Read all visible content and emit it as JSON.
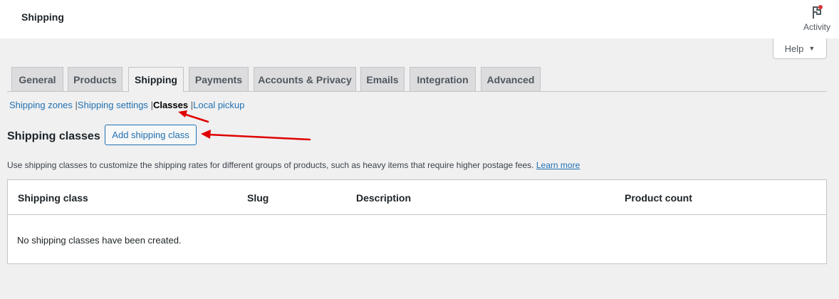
{
  "header": {
    "title": "Shipping",
    "activity_label": "Activity"
  },
  "help": {
    "label": "Help"
  },
  "tabs": [
    {
      "label": "General",
      "active": false
    },
    {
      "label": "Products",
      "active": false
    },
    {
      "label": "Shipping",
      "active": true
    },
    {
      "label": "Payments",
      "active": false
    },
    {
      "label": "Accounts & Privacy",
      "active": false
    },
    {
      "label": "Emails",
      "active": false
    },
    {
      "label": "Integration",
      "active": false
    },
    {
      "label": "Advanced",
      "active": false
    }
  ],
  "subnav": {
    "zones": "Shipping zones",
    "settings": "Shipping settings",
    "classes": "Classes",
    "local_pickup": "Local pickup",
    "separator": "|"
  },
  "section": {
    "heading": "Shipping classes",
    "add_button": "Add shipping class",
    "description": "Use shipping classes to customize the shipping rates for different groups of products, such as heavy items that require higher postage fees.",
    "learn_more": "Learn more"
  },
  "table": {
    "columns": [
      "Shipping class",
      "Slug",
      "Description",
      "Product count"
    ],
    "empty_message": "No shipping classes have been created."
  },
  "colors": {
    "link": "#2271b1",
    "annotation_arrow": "#e00000",
    "notification_dot": "#d63638"
  }
}
